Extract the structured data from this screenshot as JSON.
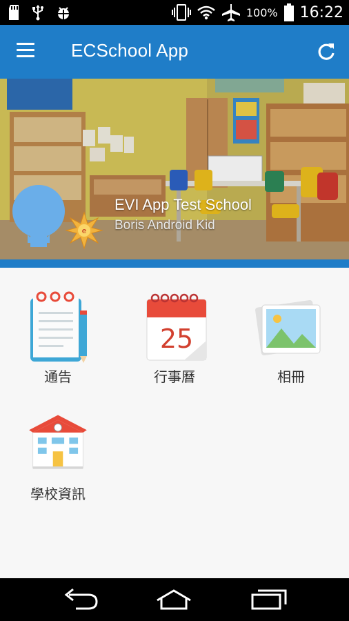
{
  "status_bar": {
    "battery_percent": "100%",
    "time": "16:22",
    "icons": [
      "sd-card-icon",
      "usb-icon",
      "android-debug-icon",
      "vibrate-icon",
      "wifi-icon",
      "airplane-icon",
      "battery-icon"
    ]
  },
  "app_bar": {
    "title": "ECSchool App",
    "background": "#1f7dc8"
  },
  "banner": {
    "school_name": "EVI App Test School",
    "kid_name": "Boris Android Kid"
  },
  "menu": [
    {
      "label": "通告",
      "icon": "notebook-icon"
    },
    {
      "label": "行事曆",
      "icon": "calendar-icon",
      "date_number": "25"
    },
    {
      "label": "相冊",
      "icon": "photo-album-icon"
    },
    {
      "label": "學校資訊",
      "icon": "school-building-icon"
    }
  ],
  "nav_bar": {
    "icons": [
      "back-icon",
      "home-icon",
      "recent-apps-icon"
    ]
  }
}
